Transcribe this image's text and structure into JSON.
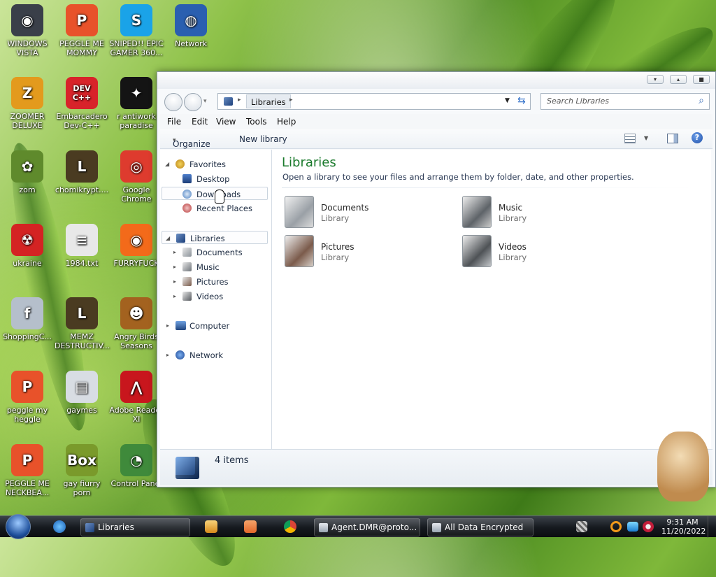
{
  "desktop": {
    "icons": [
      {
        "label": "WINDOWS VISTA",
        "glyph": "◉",
        "color": "#3a3f49"
      },
      {
        "label": "PEGGLE ME MOMMY",
        "glyph": "P",
        "color": "#e8522a"
      },
      {
        "label": "SNIPED!! EPIC GAMER 360...",
        "glyph": "S",
        "color": "#1aa3e8"
      },
      {
        "label": "Network",
        "glyph": "◍",
        "color": "#2a5fb0"
      },
      {
        "label": "ZOOMER DELUXE",
        "glyph": "Z",
        "color": "#e39a1d"
      },
      {
        "label": "Embarcadero Dev-C++",
        "glyph": "DEV C++",
        "color": "#d8232a"
      },
      {
        "label": "r antiwork paradise",
        "glyph": "✦",
        "color": "#141414"
      },
      {
        "label": "zom",
        "glyph": "✿",
        "color": "#5f8a2c"
      },
      {
        "label": "chomikrypt....",
        "glyph": "L",
        "color": "#4a3b21"
      },
      {
        "label": "Google Chrome",
        "glyph": "◎",
        "color": "#de3b2e"
      },
      {
        "label": "ukraine",
        "glyph": "☢",
        "color": "#d42323"
      },
      {
        "label": "1984.txt",
        "glyph": "≡",
        "color": "#e8e8e8"
      },
      {
        "label": "FURRYFUCK",
        "glyph": "◉",
        "color": "#f36a1a"
      },
      {
        "label": "ShoppingC...",
        "glyph": "f",
        "color": "#b5bfcb"
      },
      {
        "label": "MEMZ DESTRUCTIV...",
        "glyph": "L",
        "color": "#4a3b21"
      },
      {
        "label": "Angry Birds Seasons",
        "glyph": "☻",
        "color": "#a3621f"
      },
      {
        "label": "peggle my heggle",
        "glyph": "P",
        "color": "#e8522a"
      },
      {
        "label": "gaymes",
        "glyph": "▤",
        "color": "#d8dde3"
      },
      {
        "label": "Adobe Reader XI",
        "glyph": "⋀",
        "color": "#c8161d"
      },
      {
        "label": "PEGGLE ME NECKBEA...",
        "glyph": "P",
        "color": "#e8522a"
      },
      {
        "label": "gay fiurry porn",
        "glyph": "Box",
        "color": "#7a9a2b"
      },
      {
        "label": "Control Panel",
        "glyph": "◔",
        "color": "#3f8a3b"
      }
    ]
  },
  "window": {
    "address": {
      "crumb": "Libraries"
    },
    "search": {
      "placeholder": "Search Libraries"
    },
    "menu": [
      "File",
      "Edit",
      "View",
      "Tools",
      "Help"
    ],
    "toolbar": {
      "organize": "Organize",
      "organize_arrow": "▾",
      "new_library": "New library"
    },
    "nav": {
      "favorites": "Favorites",
      "favorites_items": [
        "Desktop",
        "Downloads",
        "Recent Places"
      ],
      "libraries": "Libraries",
      "libraries_items": [
        "Documents",
        "Music",
        "Pictures",
        "Videos"
      ],
      "computer": "Computer",
      "network": "Network"
    },
    "content": {
      "title": "Libraries",
      "subtitle": "Open a library to see your files and arrange them by folder, date, and other properties.",
      "libraries": [
        {
          "name": "Documents",
          "type": "Library"
        },
        {
          "name": "Music",
          "type": "Library"
        },
        {
          "name": "Pictures",
          "type": "Library"
        },
        {
          "name": "Videos",
          "type": "Library"
        }
      ]
    },
    "details": {
      "count": "4 items"
    }
  },
  "taskbar": {
    "buttons": [
      "Libraries",
      "Agent.DMR@proto...",
      "All Data Encrypted"
    ],
    "clock": {
      "time": "9:31 AM",
      "date": "11/20/2022"
    }
  }
}
